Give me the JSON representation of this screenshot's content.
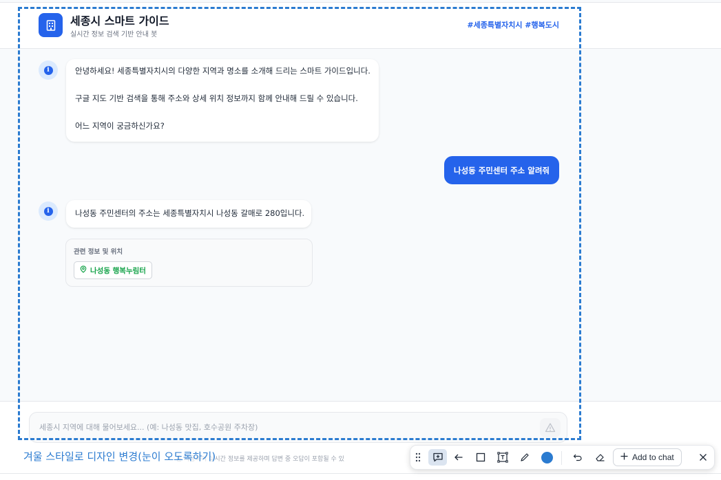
{
  "header": {
    "title": "세종시 스마트 가이드",
    "subtitle": "실시간 정보 검색 기반 안내 봇",
    "hashtags": "#세종특별자치시 #행복도시"
  },
  "messages": {
    "bot1_lines": [
      "안녕하세요! 세종특별자치시의 다양한 지역과 명소를 소개해 드리는 스마트 가이드입니다.",
      "구글 지도 기반 검색을 통해 주소와 상세 위치 정보까지 함께 안내해 드릴 수 있습니다.",
      "어느 지역이 궁금하신가요?"
    ],
    "user1": "나성동 주민센터 주소 알려줘",
    "bot2": "나성동 주민센터의 주소는 세종특별자치시 나성동 갈매로 280입니다.",
    "info_card": {
      "title": "관련 정보 및 위치",
      "place": "나성동 행복누림터"
    }
  },
  "composer": {
    "placeholder": "세종시 지역에 대해 물어보세요... (예: 나성동 맛집, 호수공원 주차장)",
    "disclaimer": "을 사용하여 실시간 정보를 제공하며 답변 중 오답이 포함될 수 있"
  },
  "overlay": {
    "instruction": "겨울 스타일로 디자인 변경(눈이 오도록하기)",
    "add_to_chat": "Add to chat",
    "selected_color": "#2b7bd0"
  }
}
